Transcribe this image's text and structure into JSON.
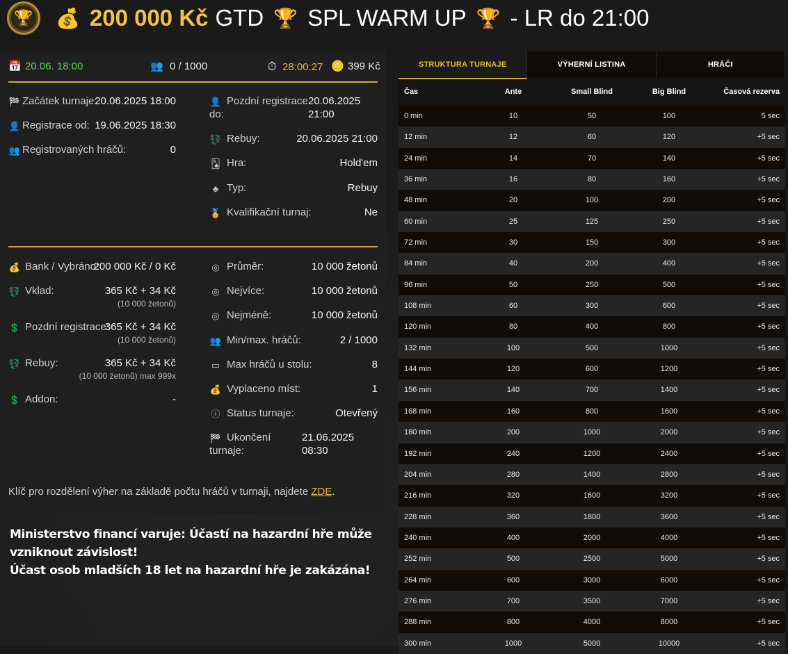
{
  "header": {
    "prize": "200 000 Kč",
    "gtd": "GTD",
    "name": "SPL WARM UP",
    "suffix": "- LR do 21:00"
  },
  "summary": {
    "date": "20.06. 18:00",
    "players": "0 / 1000",
    "countdown": "28:00:27",
    "buyin": "399 Kč"
  },
  "info_left": [
    {
      "label": "Začátek turnaje:",
      "value": "20.06.2025 18:00"
    },
    {
      "label": "Registrace od:",
      "value": "19.06.2025 18:30"
    },
    {
      "label": "Registrovaných hráčů:",
      "value": "0"
    }
  ],
  "info_right": [
    {
      "label": "Pozdní registrace",
      "label2": "do:",
      "value": "20.06.2025",
      "value2": "21:00"
    },
    {
      "label": "Rebuy:",
      "value": "20.06.2025 21:00"
    },
    {
      "label": "Hra:",
      "value": "Hold'em"
    },
    {
      "label": "Typ:",
      "value": "Rebuy"
    },
    {
      "label": "Kvalifikační turnaj:",
      "value": "Ne"
    }
  ],
  "money_left": [
    {
      "label": "Bank / Vybráno:",
      "value": "200 000 Kč / 0 Kč"
    },
    {
      "label": "Vklad:",
      "value": "365 Kč + 34 Kč",
      "sub": "(10 000 žetonů)"
    },
    {
      "label": "Pozdní registrace:",
      "value": "365 Kč + 34 Kč",
      "sub": "(10 000 žetonů)"
    },
    {
      "label": "Rebuy:",
      "value": "365 Kč + 34 Kč",
      "sub": "(10 000 žetonů) max 999x"
    },
    {
      "label": "Addon:",
      "value": "-"
    }
  ],
  "money_right": [
    {
      "label": "Průměr:",
      "value": "10 000 žetonů"
    },
    {
      "label": "Nejvíce:",
      "value": "10 000 žetonů"
    },
    {
      "label": "Nejméně:",
      "value": "10 000 žetonů"
    },
    {
      "label": "Min/max. hráčů:",
      "value": "2 / 1000"
    },
    {
      "label": "Max hráčů u stolu:",
      "value": "8"
    },
    {
      "label": "Vyplaceno míst:",
      "value": "1"
    },
    {
      "label": "Status turnaje:",
      "value": "Otevřený"
    },
    {
      "label": "Ukončení",
      "label2": "turnaje:",
      "value": "21.06.2025",
      "value2": "08:30"
    }
  ],
  "footnote": {
    "text": "Klíč pro rozdělení výher na základě počtu hráčů v turnaji, najdete",
    "link": "ZDE",
    "end": "."
  },
  "warning": {
    "line1": "Ministerstvo financí varuje: Účastí na hazardní hře může vzniknout závislost!",
    "line2": "Účast osob mladších 18 let na hazardní hře je zakázána!"
  },
  "tabs": [
    "STRUKTURA TURNAJE",
    "VÝHERNÍ LISTINA",
    "HRÁČI"
  ],
  "table": {
    "headers": [
      "Čas",
      "Ante",
      "Small Blind",
      "Big Blind",
      "Časová rezerva"
    ],
    "rows": [
      [
        "0 min",
        "10",
        "50",
        "100",
        "5 sec"
      ],
      [
        "12 min",
        "12",
        "60",
        "120",
        "+5 sec"
      ],
      [
        "24 min",
        "14",
        "70",
        "140",
        "+5 sec"
      ],
      [
        "36 min",
        "16",
        "80",
        "160",
        "+5 sec"
      ],
      [
        "48 min",
        "20",
        "100",
        "200",
        "+5 sec"
      ],
      [
        "60 min",
        "25",
        "125",
        "250",
        "+5 sec"
      ],
      [
        "72 min",
        "30",
        "150",
        "300",
        "+5 sec"
      ],
      [
        "84 min",
        "40",
        "200",
        "400",
        "+5 sec"
      ],
      [
        "96 min",
        "50",
        "250",
        "500",
        "+5 sec"
      ],
      [
        "108 min",
        "60",
        "300",
        "600",
        "+5 sec"
      ],
      [
        "120 min",
        "80",
        "400",
        "800",
        "+5 sec"
      ],
      [
        "132 min",
        "100",
        "500",
        "1000",
        "+5 sec"
      ],
      [
        "144 min",
        "120",
        "600",
        "1200",
        "+5 sec"
      ],
      [
        "156 min",
        "140",
        "700",
        "1400",
        "+5 sec"
      ],
      [
        "168 min",
        "160",
        "800",
        "1600",
        "+5 sec"
      ],
      [
        "180 min",
        "200",
        "1000",
        "2000",
        "+5 sec"
      ],
      [
        "192 min",
        "240",
        "1200",
        "2400",
        "+5 sec"
      ],
      [
        "204 min",
        "280",
        "1400",
        "2800",
        "+5 sec"
      ],
      [
        "216 min",
        "320",
        "1600",
        "3200",
        "+5 sec"
      ],
      [
        "228 min",
        "360",
        "1800",
        "3600",
        "+5 sec"
      ],
      [
        "240 min",
        "400",
        "2000",
        "4000",
        "+5 sec"
      ],
      [
        "252 min",
        "500",
        "2500",
        "5000",
        "+5 sec"
      ],
      [
        "264 min",
        "600",
        "3000",
        "6000",
        "+5 sec"
      ],
      [
        "276 min",
        "700",
        "3500",
        "7000",
        "+5 sec"
      ],
      [
        "288 min",
        "800",
        "4000",
        "8000",
        "+5 sec"
      ],
      [
        "300 min",
        "1000",
        "5000",
        "10000",
        "+5 sec"
      ]
    ]
  }
}
